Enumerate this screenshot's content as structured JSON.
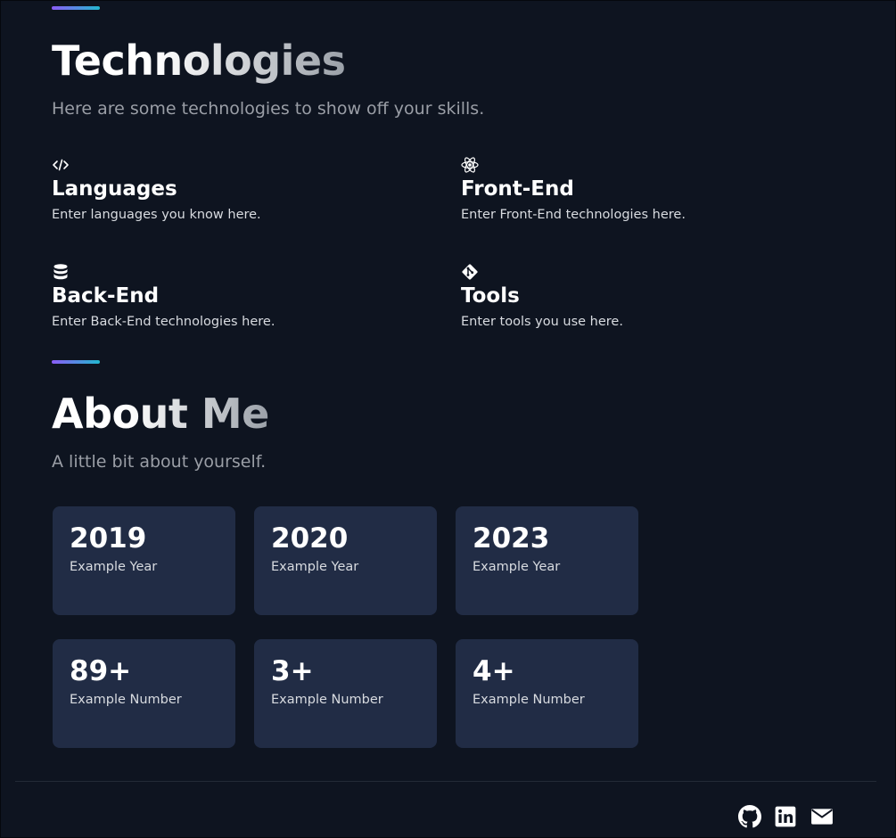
{
  "technologies": {
    "title": "Technologies",
    "subtitle": "Here are some technologies to show off your skills.",
    "items": [
      {
        "icon": "code-icon",
        "name": "Languages",
        "description": "Enter languages you know here."
      },
      {
        "icon": "react-icon",
        "name": "Front-End",
        "description": "Enter Front-End technologies here."
      },
      {
        "icon": "database-icon",
        "name": "Back-End",
        "description": "Enter Back-End technologies here."
      },
      {
        "icon": "git-icon",
        "name": "Tools",
        "description": "Enter tools you use here."
      }
    ]
  },
  "about": {
    "title": "About Me",
    "subtitle": "A little bit about yourself.",
    "cards": [
      {
        "value": "2019",
        "label": "Example Year"
      },
      {
        "value": "2020",
        "label": "Example Year"
      },
      {
        "value": "2023",
        "label": "Example Year"
      },
      {
        "value": "89+",
        "label": "Example Number"
      },
      {
        "value": "3+",
        "label": "Example Number"
      },
      {
        "value": "4+",
        "label": "Example Number"
      }
    ]
  },
  "footer": {
    "links": [
      {
        "icon": "github-icon"
      },
      {
        "icon": "linkedin-icon"
      },
      {
        "icon": "mail-icon"
      }
    ]
  },
  "colors": {
    "background": "#0e1420",
    "card": "#212c45",
    "accent_start": "#8b5cf6",
    "accent_end": "#22b8cf"
  }
}
